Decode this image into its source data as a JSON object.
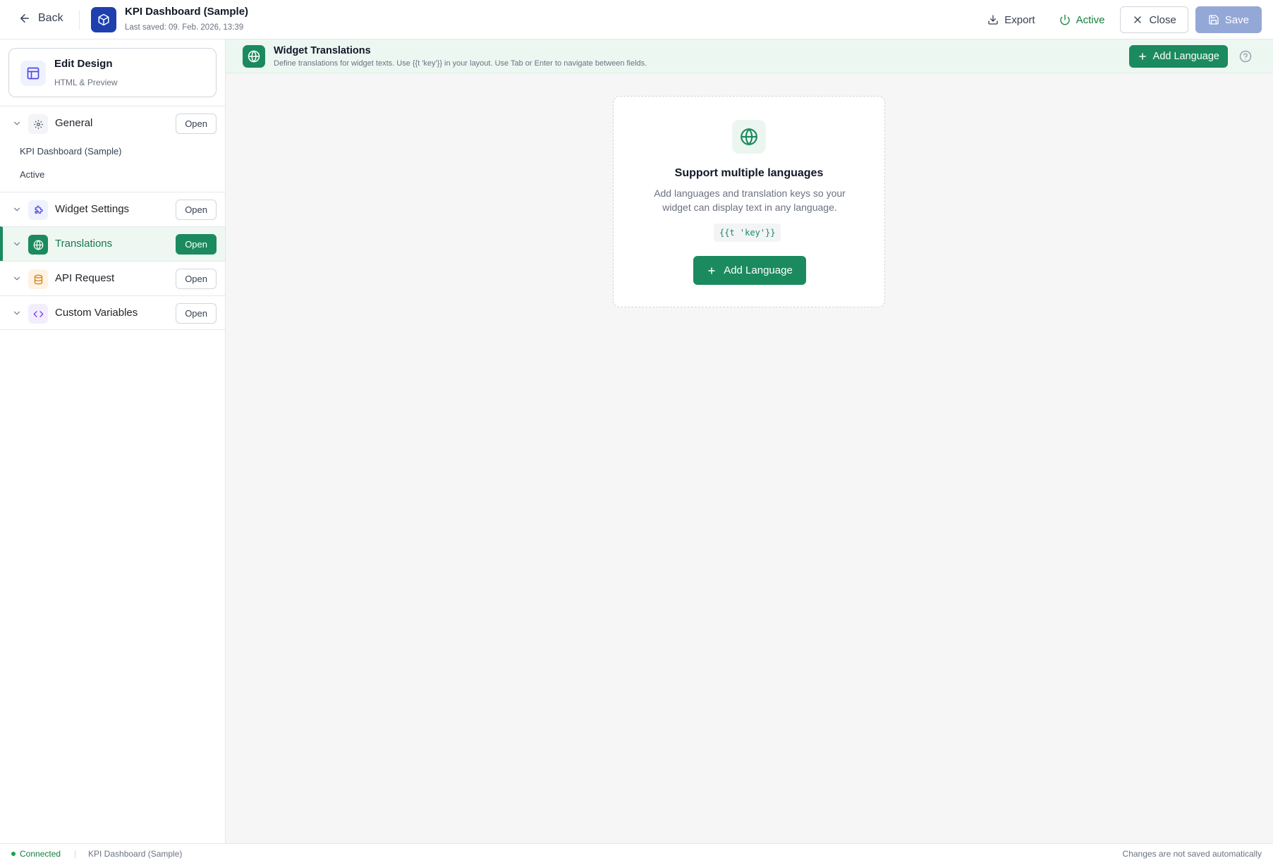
{
  "topbar": {
    "back_label": "Back",
    "title": "KPI Dashboard (Sample)",
    "last_saved": "Last saved: 09. Feb. 2026, 13:39",
    "export_label": "Export",
    "active_label": "Active",
    "close_label": "Close",
    "save_label": "Save"
  },
  "sidebar": {
    "edit_design": {
      "title": "Edit Design",
      "subtitle": "HTML & Preview"
    },
    "open_label": "Open",
    "sections": [
      {
        "label": "General",
        "icon": "gear-icon",
        "expanded": true,
        "items": [
          "KPI Dashboard (Sample)",
          "Active"
        ]
      },
      {
        "label": "Widget Settings",
        "icon": "puzzle-icon"
      },
      {
        "label": "Translations",
        "icon": "globe-icon",
        "selected": true
      },
      {
        "label": "API Request",
        "icon": "database-icon"
      },
      {
        "label": "Custom Variables",
        "icon": "code-icon"
      }
    ]
  },
  "header": {
    "title": "Widget Translations",
    "description": "Define translations for widget texts. Use {{t 'key'}} in your layout. Use Tab or Enter to navigate between fields.",
    "add_language_label": "Add Language"
  },
  "empty_state": {
    "title": "Support multiple languages",
    "description": "Add languages and translation keys so your widget can display text in any language.",
    "code_sample": "{{t 'key'}}",
    "add_language_label": "Add Language"
  },
  "statusbar": {
    "connection": "Connected",
    "widget_name": "KPI Dashboard (Sample)",
    "save_note": "Changes are not saved automatically"
  },
  "colors": {
    "accent": "#1b8a5f",
    "brand": "#1e40af",
    "save_disabled": "#93a8d6"
  }
}
